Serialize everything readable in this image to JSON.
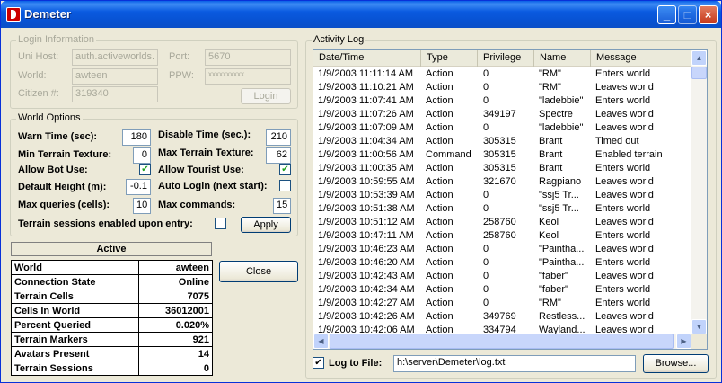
{
  "window": {
    "title": "Demeter"
  },
  "login": {
    "legend": "Login Information",
    "uni_host_label": "Uni Host:",
    "uni_host_value": "auth.activeworlds.",
    "port_label": "Port:",
    "port_value": "5670",
    "world_label": "World:",
    "world_value": "awteen",
    "ppw_label": "PPW:",
    "ppw_value": "xxxxxxxxxx",
    "citizen_label": "Citizen #:",
    "citizen_value": "319340",
    "login_button": "Login"
  },
  "world_options": {
    "legend": "World Options",
    "warn_time_label": "Warn Time (sec):",
    "warn_time_value": "180",
    "disable_time_label": "Disable Time (sec.):",
    "disable_time_value": "210",
    "min_terrain_label": "Min Terrain Texture:",
    "min_terrain_value": "0",
    "max_terrain_label": "Max Terrain Texture:",
    "max_terrain_value": "62",
    "allow_bot_label": "Allow Bot Use:",
    "allow_bot_checked": true,
    "allow_tourist_label": "Allow Tourist Use:",
    "allow_tourist_checked": true,
    "default_height_label": "Default Height (m):",
    "default_height_value": "-0.1",
    "auto_login_label": "Auto Login (next start):",
    "auto_login_checked": false,
    "max_queries_label": "Max queries (cells):",
    "max_queries_value": "10",
    "max_commands_label": "Max commands:",
    "max_commands_value": "15",
    "terrain_sessions_label": "Terrain sessions enabled upon entry:",
    "terrain_sessions_checked": false,
    "apply_button": "Apply"
  },
  "status": {
    "title": "Active",
    "rows": [
      {
        "label": "World",
        "value": "awteen"
      },
      {
        "label": "Connection State",
        "value": "Online"
      },
      {
        "label": "Terrain Cells",
        "value": "7075"
      },
      {
        "label": "Cells In World",
        "value": "36012001"
      },
      {
        "label": "Percent Queried",
        "value": "0.020%"
      },
      {
        "label": "Terrain Markers",
        "value": "921"
      },
      {
        "label": "Avatars Present",
        "value": "14"
      },
      {
        "label": "Terrain Sessions",
        "value": "0"
      }
    ]
  },
  "close_button": "Close",
  "activity_log": {
    "legend": "Activity Log",
    "columns": [
      "Date/Time",
      "Type",
      "Privilege",
      "Name",
      "Message"
    ],
    "rows": [
      [
        "1/9/2003 11:11:14 AM",
        "Action",
        "0",
        "\"RM\"",
        "Enters world"
      ],
      [
        "1/9/2003 11:10:21 AM",
        "Action",
        "0",
        "\"RM\"",
        "Leaves world"
      ],
      [
        "1/9/2003 11:07:41 AM",
        "Action",
        "0",
        "\"ladebbie\"",
        "Enters world"
      ],
      [
        "1/9/2003 11:07:26 AM",
        "Action",
        "349197",
        "Spectre",
        "Leaves world"
      ],
      [
        "1/9/2003 11:07:09 AM",
        "Action",
        "0",
        "\"ladebbie\"",
        "Leaves world"
      ],
      [
        "1/9/2003 11:04:34 AM",
        "Action",
        "305315",
        "Brant",
        "Timed out"
      ],
      [
        "1/9/2003 11:00:56 AM",
        "Command",
        "305315",
        "Brant",
        "Enabled terrain"
      ],
      [
        "1/9/2003 11:00:35 AM",
        "Action",
        "305315",
        "Brant",
        "Enters world"
      ],
      [
        "1/9/2003 10:59:55 AM",
        "Action",
        "321670",
        "Ragpiano",
        "Leaves world"
      ],
      [
        "1/9/2003 10:53:39 AM",
        "Action",
        "0",
        "\"ssj5 Tr...",
        "Leaves world"
      ],
      [
        "1/9/2003 10:51:38 AM",
        "Action",
        "0",
        "\"ssj5 Tr...",
        "Enters world"
      ],
      [
        "1/9/2003 10:51:12 AM",
        "Action",
        "258760",
        "Keol",
        "Leaves world"
      ],
      [
        "1/9/2003 10:47:11 AM",
        "Action",
        "258760",
        "Keol",
        "Enters world"
      ],
      [
        "1/9/2003 10:46:23 AM",
        "Action",
        "0",
        "\"Paintha...",
        "Leaves world"
      ],
      [
        "1/9/2003 10:46:20 AM",
        "Action",
        "0",
        "\"Paintha...",
        "Enters world"
      ],
      [
        "1/9/2003 10:42:43 AM",
        "Action",
        "0",
        "\"faber\"",
        "Leaves world"
      ],
      [
        "1/9/2003 10:42:34 AM",
        "Action",
        "0",
        "\"faber\"",
        "Enters world"
      ],
      [
        "1/9/2003 10:42:27 AM",
        "Action",
        "0",
        "\"RM\"",
        "Enters world"
      ],
      [
        "1/9/2003 10:42:26 AM",
        "Action",
        "349769",
        "Restless...",
        "Leaves world"
      ],
      [
        "1/9/2003 10:42:06 AM",
        "Action",
        "334794",
        "Wayland...",
        "Leaves world"
      ]
    ],
    "log_to_file_label": "Log to File:",
    "log_to_file_checked": true,
    "log_path": "h:\\server\\Demeter\\log.txt",
    "browse_button": "Browse..."
  }
}
